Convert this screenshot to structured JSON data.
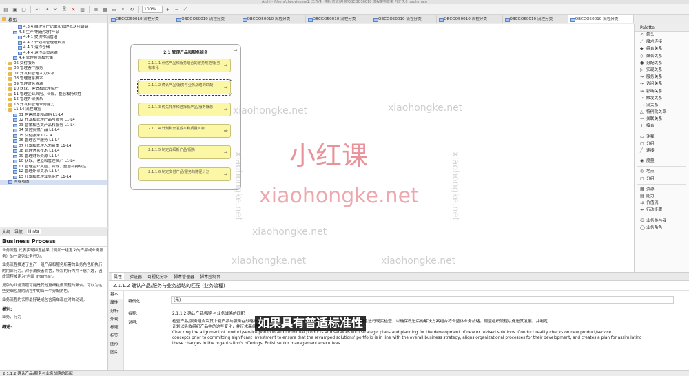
{
  "window": {
    "title": "Archi - /Users/zhouyingen/1. 工作/4. 任新·管道/咨询/OBCGO50010 流程架构框架 PCF 7.0 .archimate"
  },
  "toolbar": {
    "zoom": "100%"
  },
  "model_tree": {
    "tab_label": "模型",
    "items": [
      {
        "label": "4.3.4 维护生产记录和管理批次可跟踪",
        "indent": 3,
        "kind": "proc"
      },
      {
        "label": "4.3 生产/制造/交付产品",
        "indent": 2,
        "kind": "proc"
      },
      {
        "label": "4.4.1 提供物流管治",
        "indent": 3,
        "kind": "proc"
      },
      {
        "label": "4.4.2 计划和管理进料流",
        "indent": 3,
        "kind": "proc"
      },
      {
        "label": "4.4.3 运作仓储",
        "indent": 3,
        "kind": "proc"
      },
      {
        "label": "4.4.4 运作出货运输",
        "indent": 3,
        "kind": "proc"
      },
      {
        "label": "4.4 管理物流和仓储",
        "indent": 2,
        "kind": "proc"
      },
      {
        "label": "05 交付服务",
        "indent": 1,
        "kind": "folder"
      },
      {
        "label": "06 管理客户服务",
        "indent": 1,
        "kind": "folder"
      },
      {
        "label": "07 开发和管理人力资本",
        "indent": 1,
        "kind": "folder"
      },
      {
        "label": "08 管理信息技术",
        "indent": 1,
        "kind": "folder"
      },
      {
        "label": "09 管理财务资源",
        "indent": 1,
        "kind": "folder"
      },
      {
        "label": "10 获取、建造和管理资产",
        "indent": 1,
        "kind": "folder"
      },
      {
        "label": "11 管理企业风险、合规、整治和持续性",
        "indent": 1,
        "kind": "folder"
      },
      {
        "label": "12 管理外部关系",
        "indent": 1,
        "kind": "folder"
      },
      {
        "label": "13 开发和管理业务能力",
        "indent": 1,
        "kind": "folder"
      },
      {
        "label": "L1-L4 流程概览",
        "indent": 1,
        "kind": "folder"
      },
      {
        "label": "01 构建愿景和战略 L1-L4",
        "indent": 2,
        "kind": "proc"
      },
      {
        "label": "02 开发和管理产品与服务 L1-L4",
        "indent": 2,
        "kind": "proc"
      },
      {
        "label": "03 营销和售卖产品和服务 L1-L4",
        "indent": 2,
        "kind": "proc"
      },
      {
        "label": "04 交付实物产品 L1-L4",
        "indent": 2,
        "kind": "proc"
      },
      {
        "label": "05 交付服务 L1-L4",
        "indent": 2,
        "kind": "proc"
      },
      {
        "label": "06 管理客户服务 L1-L4",
        "indent": 2,
        "kind": "proc"
      },
      {
        "label": "07 开发和管理人力资本 L1-L4",
        "indent": 2,
        "kind": "proc"
      },
      {
        "label": "08 管理信息技术 L1-L4",
        "indent": 2,
        "kind": "proc"
      },
      {
        "label": "09 管理财务资源 L1-L4",
        "indent": 2,
        "kind": "proc"
      },
      {
        "label": "10 获取、建造和管理资产 L1-L4",
        "indent": 2,
        "kind": "proc"
      },
      {
        "label": "11 管理企业风险、合规、整治和持续性",
        "indent": 2,
        "kind": "proc"
      },
      {
        "label": "12 管理外部关系 L1-L4",
        "indent": 2,
        "kind": "proc"
      },
      {
        "label": "13 开发和管理业务能力 L1-L4",
        "indent": 2,
        "kind": "proc"
      },
      {
        "label": "流程地图",
        "indent": 1,
        "kind": "proc",
        "selected": true
      }
    ]
  },
  "hints": {
    "tabs": [
      "大纲",
      "导航",
      "Hints"
    ],
    "title": "Business Process",
    "paragraphs": [
      "业务流程 代表实现特定结果（例如一组定义的产品或业务服务）的一系列业务行为。",
      "业务流程描述了生产一组产品和服务所需的业务角色所执行的内部行为。对于消费者而言，所需的行为并不感兴趣，因此流程被定为\"内部 Internal\"。",
      "复杂的业务流程可能是其他更细粒度流程的聚合。可以为这些更细粒度的流程中的每一个分配角色。",
      "业务流程的名称最好是或包含简单现在时的动词。"
    ],
    "section_label": "类别:",
    "section_value": "业务、行为",
    "footer_label": "概述:"
  },
  "editor": {
    "tabs": [
      "OBCGO50010 流程分类",
      "OBCGO50010 流程分类",
      "OBCGO50010 流程分类",
      "OBCGO50010 流程分类",
      "OBCGO50010 流程分类",
      "OBCGO50010 流程分类",
      "OBCGO50010 流程分类",
      "OBCGO50010 流程分类"
    ],
    "group_title": "2.1 管理产品和服务组合",
    "processes": [
      "2.1.1.1 评估产品和服务组合的服务规范/服务标准化",
      "2.1.1.2 确认产品/服务与业务战略的匹配",
      "2.1.1.3 优先排序和选择新产品/服务概念",
      "2.1.1.4 计划和开发成本和质量目标",
      "2.1.1.5 制定详细新产品/服务",
      "2.1.1.6 制定交付产品/服务的路径计划"
    ]
  },
  "palette": {
    "title": "Palette",
    "groups": [
      [
        {
          "icon": "↗",
          "label": "箭头"
        },
        {
          "icon": "⟋",
          "label": "魔术连接"
        },
        {
          "icon": "◆",
          "label": "组合关系"
        },
        {
          "icon": "◇",
          "label": "聚合关系"
        },
        {
          "icon": "●",
          "label": "分配关系"
        },
        {
          "icon": "▷",
          "label": "实现关系"
        },
        {
          "icon": "→",
          "label": "服务关系"
        },
        {
          "icon": "⇢",
          "label": "访问关系"
        },
        {
          "icon": "⇝",
          "label": "影响关系"
        },
        {
          "icon": "➝",
          "label": "触发关系"
        },
        {
          "icon": "⤍",
          "label": "流关系"
        },
        {
          "icon": "△",
          "label": "特例化关系"
        },
        {
          "icon": "—",
          "label": "关联关系"
        },
        {
          "icon": "+",
          "label": "接合"
        }
      ],
      [
        {
          "icon": "▭",
          "label": "注释"
        },
        {
          "icon": "▢",
          "label": "分组"
        },
        {
          "icon": "╱",
          "label": "连接"
        }
      ],
      [
        {
          "icon": "◉",
          "label": "度量"
        }
      ],
      [
        {
          "icon": "◎",
          "label": "地点"
        },
        {
          "icon": "▢",
          "label": "分组"
        }
      ],
      [
        {
          "icon": "▦",
          "label": "资源"
        },
        {
          "icon": "▤",
          "label": "能力"
        },
        {
          "icon": "⇉",
          "label": "价值流"
        },
        {
          "icon": "↠",
          "label": "行动步骤"
        }
      ],
      [
        {
          "icon": "☺",
          "label": "业务参与者"
        },
        {
          "icon": "◯",
          "label": "业务角色"
        }
      ]
    ]
  },
  "properties": {
    "tabs": [
      "属性",
      "验证器",
      "可视化分析",
      "脚本管理器",
      "脚本控制台"
    ],
    "title": "2.1.1.2 确认产品/服务与业务战略的匹配 (业务流程)",
    "side": [
      "基本",
      "属性",
      "分析",
      "外观",
      "标题",
      "标签",
      "图形",
      "图片"
    ],
    "specialization_label": "特例化:",
    "specialization_value": "(无)",
    "name_label": "名称:",
    "name_value": "2.1.1.2 确认产品/服务与业务战略的匹配",
    "doc_label": "说明:",
    "doc_lines": [
      "检查产品/服务组合及其个别产品与服务在战略计划中的定位。组织性地开发产品/服务战略计划的产品/服务概念进行现实检查，以确保改进后的解决方案组合符合整体业务战略。调整组织流程以促进其发展，并制定",
      "计划以吸收组织产品中的这些变化，并征求高级管理层的意见。",
      "Checking the alignment of product/service portfolio and individual products and services with strategic plans and planning for the development of new or revised solutions. Conduct reality checks on new product/service",
      "concepts prior to committing significant investment to ensure that the revamped solutions' portfolio is in line with the overall business strategy, aligns organizational processes for their development, and creates a plan for assimilating",
      "these changes in the organization's offerings. Enlist senior management executives."
    ]
  },
  "overlay": {
    "watermark_small": "xiaohongke.net",
    "watermark_big_cn": "小红课",
    "watermark_big_en": "xiaohongke.net",
    "subtitle": "如果具有普适标准性"
  },
  "statusbar": {
    "text": "2.1.1.2 确认产品/服务与业务战略的匹配"
  }
}
